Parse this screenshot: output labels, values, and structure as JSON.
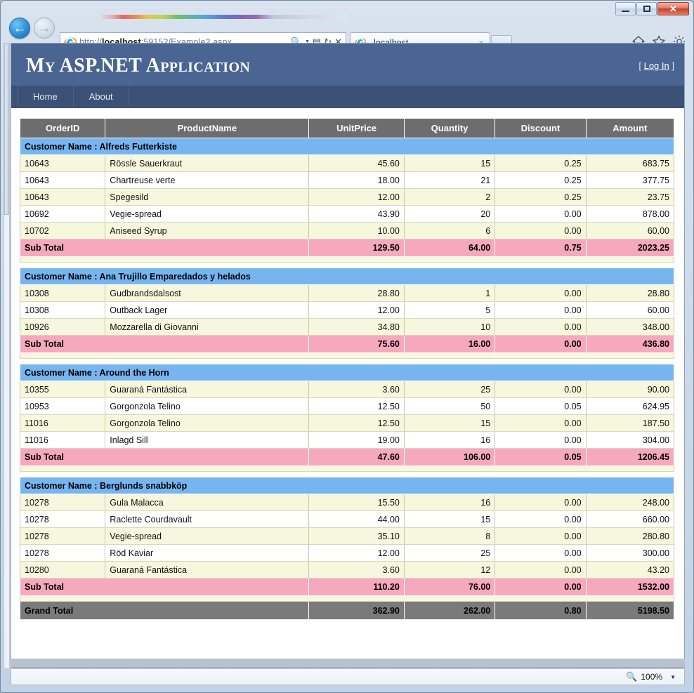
{
  "browser": {
    "window_controls": {
      "minimize": "minimize-button",
      "maximize": "maximize-button",
      "close": "close-button"
    },
    "back_label": "←",
    "forward_label": "→",
    "url_scheme": "http://",
    "url_host": "localhost",
    "url_rest": ":59152/Example2.aspx",
    "url_full": "http://localhost:59152/Example2.aspx",
    "addr_icons": [
      "search-icon",
      "dropdown-caret",
      "compatibility-view-icon",
      "refresh-icon",
      "stop-icon"
    ],
    "tab_title": "localhost",
    "tab_close": "×",
    "command_icons": [
      "home-icon",
      "favorites-star-icon",
      "tools-gear-icon"
    ],
    "status": {
      "zoom_level": "100%",
      "zoom_caret": "▼"
    }
  },
  "site": {
    "title": "My ASP.NET Application",
    "login_open": "[",
    "login_label": "Log In",
    "login_close": "]",
    "nav": [
      {
        "label": "Home"
      },
      {
        "label": "About"
      }
    ]
  },
  "grid": {
    "columns": [
      "OrderID",
      "ProductName",
      "UnitPrice",
      "Quantity",
      "Discount",
      "Amount"
    ],
    "group_label_prefix": "Customer Name : ",
    "subtotal_label": "Sub Total",
    "grandtotal_label": "Grand Total",
    "groups": [
      {
        "customer": "Alfreds Futterkiste",
        "header": "Customer Name : Alfreds Futterkiste",
        "rows": [
          {
            "order_id": "10643",
            "product": "Rössle Sauerkraut",
            "unit_price": "45.60",
            "quantity": "15",
            "discount": "0.25",
            "amount": "683.75"
          },
          {
            "order_id": "10643",
            "product": "Chartreuse verte",
            "unit_price": "18.00",
            "quantity": "21",
            "discount": "0.25",
            "amount": "377.75"
          },
          {
            "order_id": "10643",
            "product": "Spegesild",
            "unit_price": "12.00",
            "quantity": "2",
            "discount": "0.25",
            "amount": "23.75"
          },
          {
            "order_id": "10692",
            "product": "Vegie-spread",
            "unit_price": "43.90",
            "quantity": "20",
            "discount": "0.00",
            "amount": "878.00"
          },
          {
            "order_id": "10702",
            "product": "Aniseed Syrup",
            "unit_price": "10.00",
            "quantity": "6",
            "discount": "0.00",
            "amount": "60.00"
          }
        ],
        "subtotal": {
          "unit_price": "129.50",
          "quantity": "64.00",
          "discount": "0.75",
          "amount": "2023.25"
        }
      },
      {
        "customer": "Ana Trujillo Emparedados y helados",
        "header": "Customer Name : Ana Trujillo Emparedados y helados",
        "rows": [
          {
            "order_id": "10308",
            "product": "Gudbrandsdalsost",
            "unit_price": "28.80",
            "quantity": "1",
            "discount": "0.00",
            "amount": "28.80"
          },
          {
            "order_id": "10308",
            "product": "Outback Lager",
            "unit_price": "12.00",
            "quantity": "5",
            "discount": "0.00",
            "amount": "60.00"
          },
          {
            "order_id": "10926",
            "product": "Mozzarella di Giovanni",
            "unit_price": "34.80",
            "quantity": "10",
            "discount": "0.00",
            "amount": "348.00"
          }
        ],
        "subtotal": {
          "unit_price": "75.60",
          "quantity": "16.00",
          "discount": "0.00",
          "amount": "436.80"
        }
      },
      {
        "customer": "Around the Horn",
        "header": "Customer Name : Around the Horn",
        "rows": [
          {
            "order_id": "10355",
            "product": "Guaraná Fantástica",
            "unit_price": "3.60",
            "quantity": "25",
            "discount": "0.00",
            "amount": "90.00"
          },
          {
            "order_id": "10953",
            "product": "Gorgonzola Telino",
            "unit_price": "12.50",
            "quantity": "50",
            "discount": "0.05",
            "amount": "624.95"
          },
          {
            "order_id": "11016",
            "product": "Gorgonzola Telino",
            "unit_price": "12.50",
            "quantity": "15",
            "discount": "0.00",
            "amount": "187.50"
          },
          {
            "order_id": "11016",
            "product": "Inlagd Sill",
            "unit_price": "19.00",
            "quantity": "16",
            "discount": "0.00",
            "amount": "304.00"
          }
        ],
        "subtotal": {
          "unit_price": "47.60",
          "quantity": "106.00",
          "discount": "0.05",
          "amount": "1206.45"
        }
      },
      {
        "customer": "Berglunds snabbköp",
        "header": "Customer Name : Berglunds snabbköp",
        "rows": [
          {
            "order_id": "10278",
            "product": "Gula Malacca",
            "unit_price": "15.50",
            "quantity": "16",
            "discount": "0.00",
            "amount": "248.00"
          },
          {
            "order_id": "10278",
            "product": "Raclette Courdavault",
            "unit_price": "44.00",
            "quantity": "15",
            "discount": "0.00",
            "amount": "660.00"
          },
          {
            "order_id": "10278",
            "product": "Vegie-spread",
            "unit_price": "35.10",
            "quantity": "8",
            "discount": "0.00",
            "amount": "280.80"
          },
          {
            "order_id": "10278",
            "product": "Röd Kaviar",
            "unit_price": "12.00",
            "quantity": "25",
            "discount": "0.00",
            "amount": "300.00"
          },
          {
            "order_id": "10280",
            "product": "Guaraná Fantástica",
            "unit_price": "3.60",
            "quantity": "12",
            "discount": "0.00",
            "amount": "43.20"
          }
        ],
        "subtotal": {
          "unit_price": "110.20",
          "quantity": "76.00",
          "discount": "0.00",
          "amount": "1532.00"
        }
      }
    ],
    "grandtotal": {
      "unit_price": "362.90",
      "quantity": "262.00",
      "discount": "0.80",
      "amount": "5198.50"
    }
  },
  "colors": {
    "header_band": "#4a6591",
    "nav_band": "#3c5176",
    "col_header": "#6d6d6d",
    "group_header": "#76b5f0",
    "alt_row": "#f7f7dd",
    "subtotal": "#f6a8bd",
    "grand_total": "#7a7a7a"
  }
}
